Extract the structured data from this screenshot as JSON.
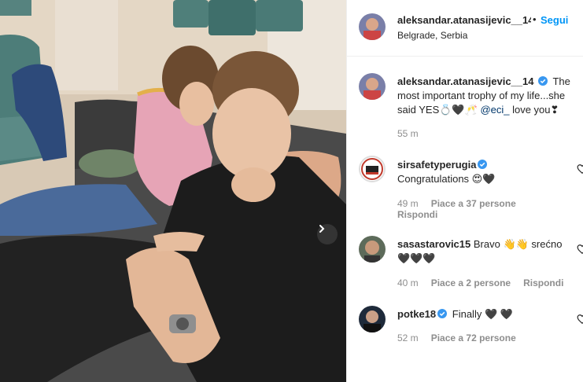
{
  "post": {
    "username": "aleksandar.atanasijevic__14",
    "follow_label": "Segui",
    "separator": "•",
    "location": "Belgrade, Serbia",
    "caption": {
      "username": "aleksandar.atanasijevic__14",
      "text_before_mention": "The most important trophy of my life...she said YES💍🖤🥂",
      "mention": "@eci_",
      "text_after_mention": " love you❣",
      "time": "55 m"
    }
  },
  "comments": [
    {
      "username": "sirsafetyperugia",
      "verified": true,
      "text": "Congratulations 😍🖤",
      "time": "49 m",
      "likes": "Piace a 37 persone",
      "reply": "Rispondi"
    },
    {
      "username": "sasastarovic15",
      "verified": false,
      "text": "Bravo 👋👋 srećno 🖤🖤🖤",
      "time": "40 m",
      "likes": "Piace a 2 persone",
      "reply": "Rispondi"
    },
    {
      "username": "potke18",
      "verified": true,
      "text": "Finally 🖤 🖤",
      "time": "52 m",
      "likes": "Piace a 72 persone",
      "reply": ""
    }
  ],
  "icons": {
    "verified": "verified-badge-icon",
    "like": "heart-outline-icon",
    "next": "chevron-right-icon"
  },
  "colors": {
    "link": "#0095f6",
    "verified": "#3897f0",
    "meta": "#8e8e8e",
    "text": "#262626"
  }
}
